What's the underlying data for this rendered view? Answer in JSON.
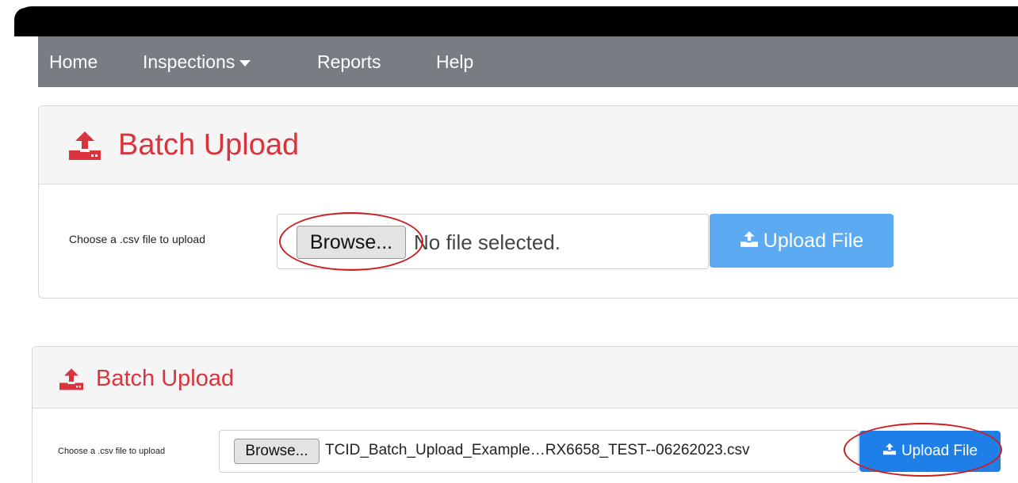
{
  "nav": {
    "items": [
      {
        "label": "Home"
      },
      {
        "label": "Inspections"
      },
      {
        "label": "Reports"
      },
      {
        "label": "Help"
      }
    ]
  },
  "panel1": {
    "title": "Batch Upload",
    "label": "Choose a .csv file to upload",
    "browse_label": "Browse...",
    "file_status": "No file selected.",
    "upload_label": "Upload File",
    "upload_color": "#5baaf2"
  },
  "panel2": {
    "title": "Batch Upload",
    "label": "Choose a .csv file to upload",
    "browse_label": "Browse...",
    "file_name": "TCID_Batch_Upload_Example…RX6658_TEST--06262023.csv",
    "upload_label": "Upload File",
    "upload_color": "#1f7fe8"
  },
  "colors": {
    "title_red": "#d9343e",
    "navbar": "#777d82",
    "highlight_ellipse": "#cc1e1e"
  }
}
